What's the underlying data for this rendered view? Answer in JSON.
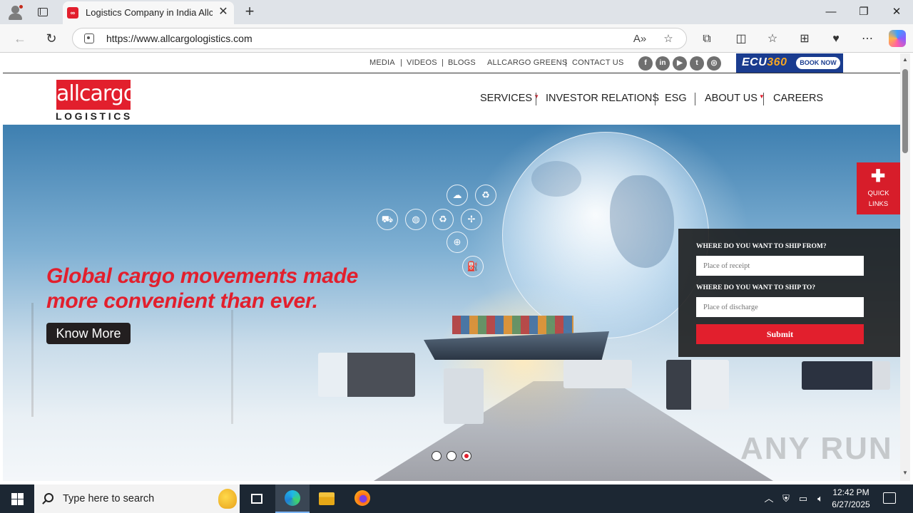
{
  "browser": {
    "tab_title": "Logistics Company in India Allcargo",
    "favicon_text": "∞",
    "url": "https://www.allcargologistics.com",
    "new_tab": "+",
    "close_tab": "✕",
    "window_controls": {
      "minimize": "—",
      "restore": "❐",
      "close": "✕"
    }
  },
  "topnav": {
    "links": [
      "MEDIA",
      "VIDEOS",
      "BLOGS",
      "ALLCARGO GREENS",
      "CONTACT US"
    ],
    "social": [
      {
        "icon": "facebook-icon",
        "glyph": "f"
      },
      {
        "icon": "linkedin-icon",
        "glyph": "in"
      },
      {
        "icon": "youtube-icon",
        "glyph": "▶"
      },
      {
        "icon": "twitter-icon",
        "glyph": "t"
      },
      {
        "icon": "instagram-icon",
        "glyph": "◎"
      }
    ],
    "ecu_brand_a": "ECU",
    "ecu_brand_b": "360",
    "ecu_book": "BOOK NOW"
  },
  "header": {
    "logo_text": "allcargo",
    "logo_sub": "LOGISTICS",
    "nav": [
      "SERVICES",
      "INVESTOR RELATIONS",
      "ESG",
      "ABOUT US",
      "CAREERS"
    ]
  },
  "hero": {
    "headline_line1": "Global cargo movements made",
    "headline_line2": "more convenient than ever.",
    "cta": "Know More",
    "slides": 3,
    "active_slide": 3,
    "watermark": "ANY RUN"
  },
  "quick_links": {
    "plus": "✚",
    "line1": "QUICK",
    "line2": "LINKS"
  },
  "ship_form": {
    "from_label": "WHERE DO YOU WANT TO SHIP FROM?",
    "from_placeholder": "Place of receipt",
    "to_label": "WHERE DO YOU WANT TO SHIP TO?",
    "to_placeholder": "Place of discharge",
    "submit": "Submit"
  },
  "taskbar": {
    "search_placeholder": "Type here to search",
    "time": "12:42 PM",
    "date": "6/27/2025"
  },
  "colors": {
    "brand_red": "#e21f2d",
    "taskbar": "#1c2733"
  }
}
